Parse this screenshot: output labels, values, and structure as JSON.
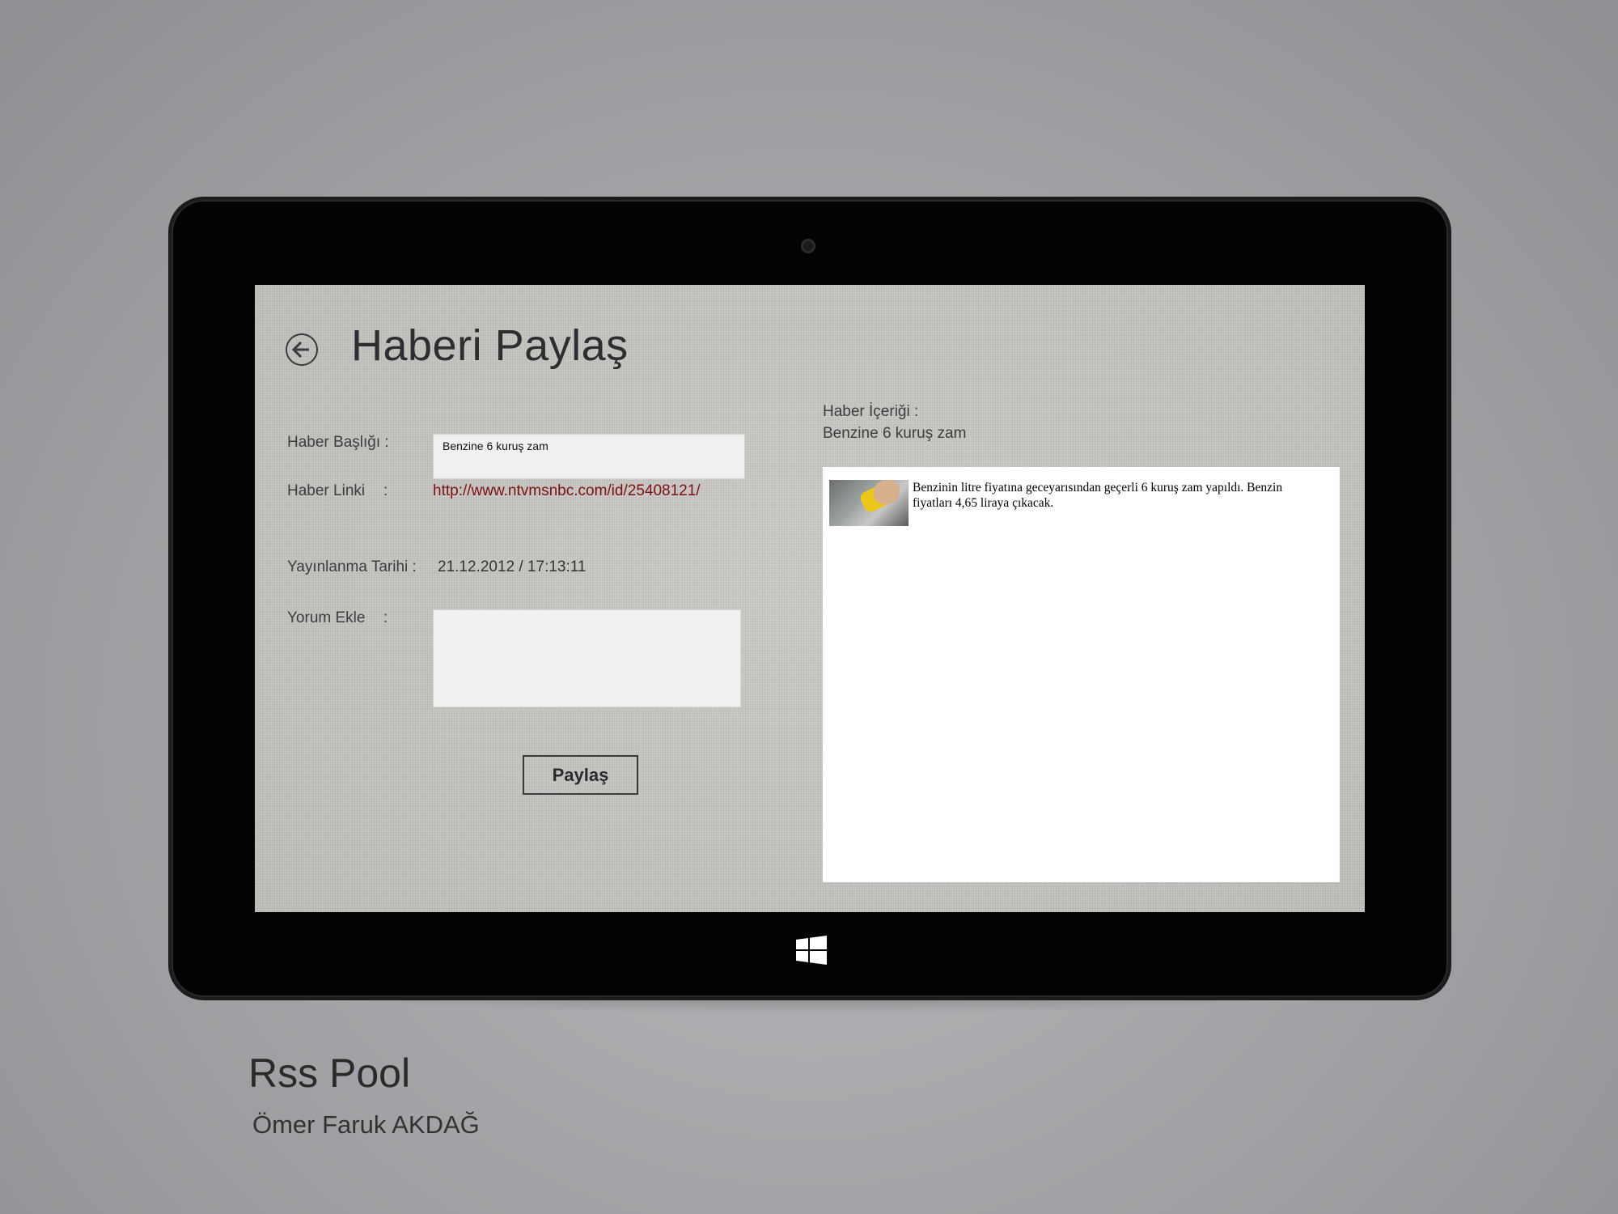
{
  "colors": {
    "background": "#a3a5a8",
    "bezel": "#030303",
    "screen_bg": "#c4c2be",
    "link": "#7a1212",
    "panel": "#ffffff"
  },
  "icons": {
    "back": "back-arrow-icon",
    "windows": "windows-logo-icon",
    "camera": "camera-icon"
  },
  "app": {
    "page_title": "Haberi Paylaş"
  },
  "form": {
    "title_label": "Haber Başlığı :",
    "title_value": "Benzine 6 kuruş zam",
    "link_label": "Haber Linki",
    "link_colon": ":",
    "link_value": "http://www.ntvmsnbc.com/id/25408121/",
    "date_label": "Yayınlanma Tarihi :",
    "date_value": "21.12.2012  / 17:13:11",
    "comment_label": "Yorum Ekle",
    "comment_colon": ":",
    "comment_value": "",
    "share_button": "Paylaş"
  },
  "content": {
    "label": "Haber İçeriği :",
    "title": "Benzine 6 kuruş zam",
    "body": "Benzinin litre fiyatına geceyarısından geçerli 6 kuruş zam yapıldı. Benzin fiyatları 4,65 liraya çıkacak."
  },
  "footer": {
    "app_name": "Rss Pool",
    "author": "Ömer Faruk AKDAĞ"
  }
}
